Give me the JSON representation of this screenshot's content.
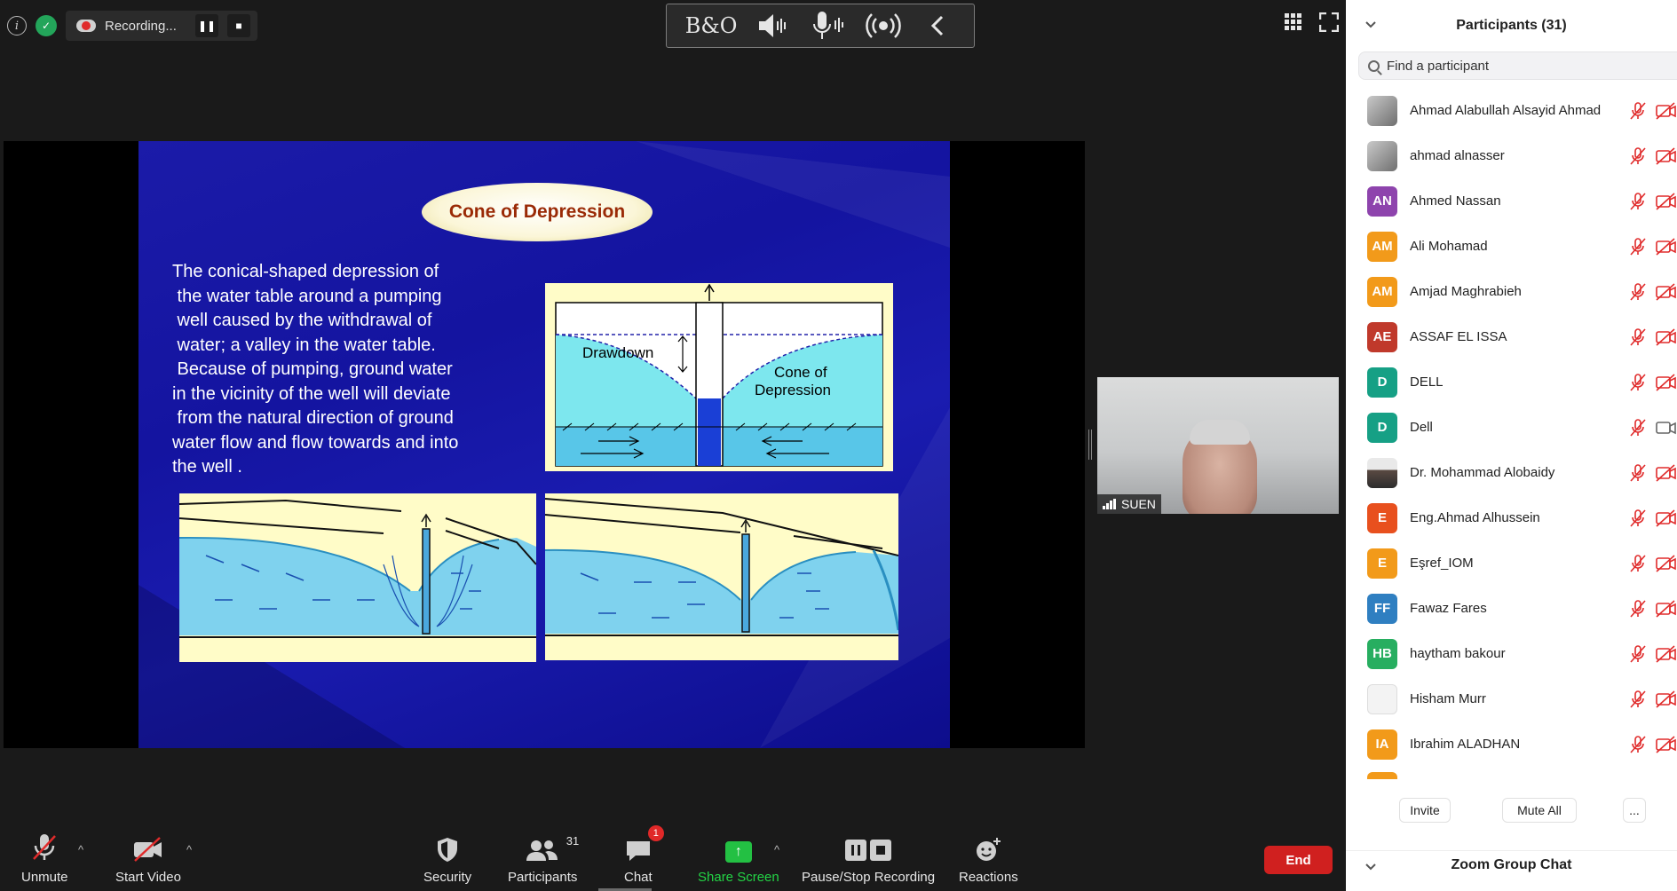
{
  "top_left": {
    "recording_label": "Recording..."
  },
  "video_tile": {
    "name": "SUEN"
  },
  "slide": {
    "title": "Cone of Depression",
    "body": "The conical-shaped depression of the water table around a pumping well caused by the withdrawal of water; a valley in the water table. Because of pumping, ground water in the vicinity of the well will deviate from the natural direction of ground water flow and flow towards and into the well .",
    "body_lines": [
      "The conical-shaped depression of",
      " the water table around a pumping",
      " well caused by the withdrawal of",
      " water; a valley in the water table.",
      " Because of pumping, ground water",
      "in the vicinity of the well will deviate",
      " from the natural direction of ground",
      "water flow and flow towards and into",
      "the well ."
    ],
    "diagram_labels": {
      "drawdown": "Drawdown",
      "cone_line1": "Cone of",
      "cone_line2": "Depression"
    }
  },
  "toolbar": {
    "unmute": "Unmute",
    "start_video": "Start Video",
    "security": "Security",
    "participants": "Participants",
    "participants_count": "31",
    "chat": "Chat",
    "chat_badge": "1",
    "share_screen": "Share Screen",
    "pause_stop_recording": "Pause/Stop Recording",
    "reactions": "Reactions",
    "end": "End"
  },
  "panel": {
    "title": "Participants (31)",
    "search_placeholder": "Find a participant",
    "participants": [
      {
        "name": "Ahmad Alabullah Alsayid Ahmad",
        "initials": "",
        "avatar_color": "photo",
        "video": "off"
      },
      {
        "name": "ahmad alnasser",
        "initials": "",
        "avatar_color": "photo",
        "video": "off"
      },
      {
        "name": "Ahmed Nassan",
        "initials": "AN",
        "avatar_color": "#8e44ad",
        "video": "off"
      },
      {
        "name": "Ali Mohamad",
        "initials": "AM",
        "avatar_color": "#f29a1a",
        "video": "off"
      },
      {
        "name": "Amjad Maghrabieh",
        "initials": "AM",
        "avatar_color": "#f29a1a",
        "video": "off"
      },
      {
        "name": "ASSAF EL ISSA",
        "initials": "AE",
        "avatar_color": "#c0392b",
        "video": "off"
      },
      {
        "name": "DELL",
        "initials": "D",
        "avatar_color": "#16a085",
        "video": "off"
      },
      {
        "name": "Dell",
        "initials": "D",
        "avatar_color": "#16a085",
        "video": "on"
      },
      {
        "name": "Dr. Mohammad Alobaidy",
        "initials": "",
        "avatar_color": "photo-person",
        "video": "off"
      },
      {
        "name": "Eng.Ahmad Alhussein",
        "initials": "E",
        "avatar_color": "#e8501e",
        "video": "off"
      },
      {
        "name": "Eşref_IOM",
        "initials": "E",
        "avatar_color": "#f29a1a",
        "video": "off"
      },
      {
        "name": "Fawaz Fares",
        "initials": "FF",
        "avatar_color": "#2f7fc1",
        "video": "off"
      },
      {
        "name": "haytham bakour",
        "initials": "HB",
        "avatar_color": "#27ae60",
        "video": "off"
      },
      {
        "name": "Hisham Murr",
        "initials": "",
        "avatar_color": "photo-blank",
        "video": "off"
      },
      {
        "name": "Ibrahim ALADHAN",
        "initials": "IA",
        "avatar_color": "#f29a1a",
        "video": "off"
      }
    ],
    "invite": "Invite",
    "mute_all": "Mute All",
    "more": "...",
    "chat_section": "Zoom Group Chat"
  },
  "colors": {
    "end_red": "#d0201f",
    "share_green": "#23c043",
    "muted_red": "#e02b2b",
    "slide_blue": "#1414a0"
  }
}
